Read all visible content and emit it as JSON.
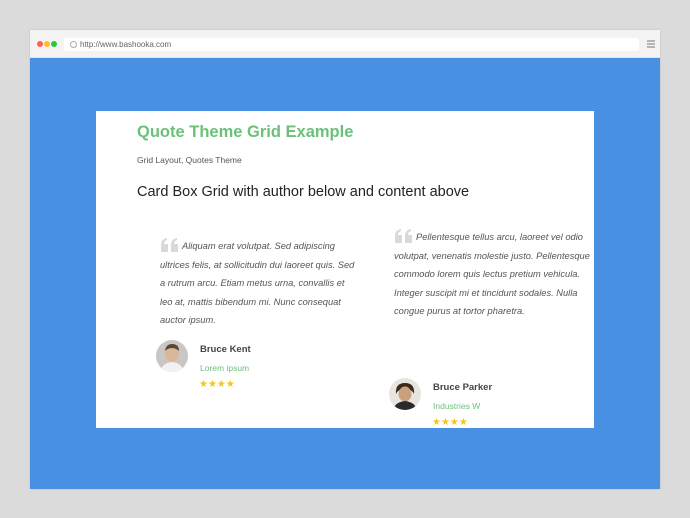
{
  "browser": {
    "url": "http://www.bashooka.com",
    "colors": {
      "red": "#ff5f57",
      "yellow": "#febc2e",
      "green": "#28c840",
      "page_bg": "#4a90e2"
    }
  },
  "page": {
    "title": "Quote Theme Grid Example",
    "subtitle": "Grid Layout, Quotes Theme",
    "heading": "Card Box Grid with author below and content above",
    "accent_color": "#6cc07a"
  },
  "quotes": [
    {
      "text": "Aliquam erat volutpat. Sed adipiscing ultrices felis, at sollicitudin dui laoreet quis. Sed a rutrum arcu. Etiam metus urna, convallis et leo at, mattis bibendum mi. Nunc consequat auctor ipsum.",
      "author": "Bruce Kent",
      "role": "Lorem ipsum",
      "stars": "★★★★",
      "rating": 4
    },
    {
      "text": "Pellentesque tellus arcu, laoreet vel odio volutpat, venenatis molestie justo. Pellentesque commodo lorem quis lectus pretium vehicula. Integer suscipit mi et tincidunt sodales. Nulla congue purus at tortor pharetra.",
      "author": "Bruce Parker",
      "role": "Industries W",
      "stars": "★★★★",
      "rating": 4
    }
  ]
}
